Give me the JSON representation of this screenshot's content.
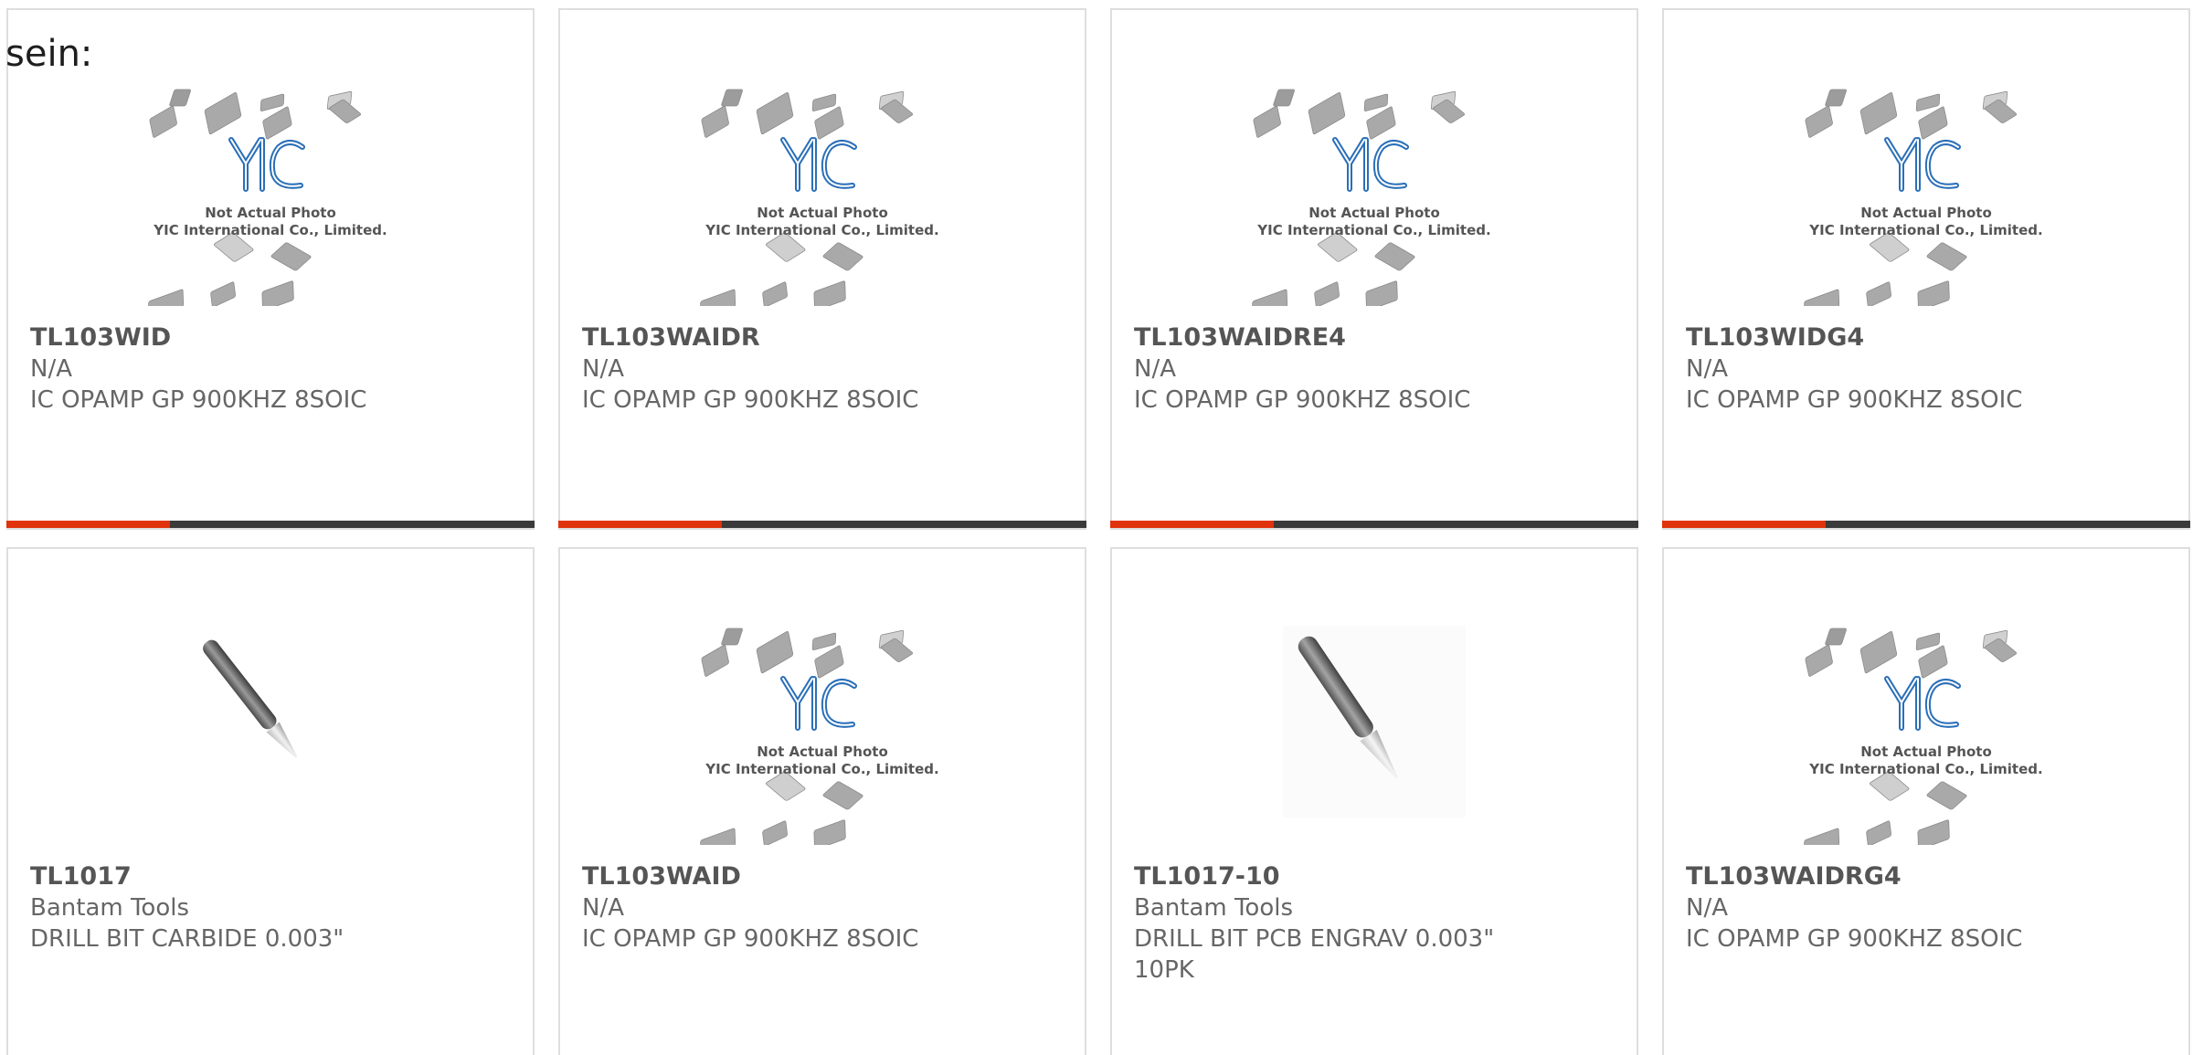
{
  "label": "sein:",
  "accent_color": "#e0320c",
  "bar_color": "#3a3a3a",
  "products": [
    {
      "part": "TL103WID",
      "mfr": "N/A",
      "desc": "IC OPAMP GP 900KHZ 8SOIC",
      "image": "yic-placeholder",
      "progress": 0.31
    },
    {
      "part": "TL103WAIDR",
      "mfr": "N/A",
      "desc": "IC OPAMP GP 900KHZ 8SOIC",
      "image": "yic-placeholder",
      "progress": 0.31
    },
    {
      "part": "TL103WAIDRE4",
      "mfr": "N/A",
      "desc": "IC OPAMP GP 900KHZ 8SOIC",
      "image": "yic-placeholder",
      "progress": 0.31
    },
    {
      "part": "TL103WIDG4",
      "mfr": "N/A",
      "desc": "IC OPAMP GP 900KHZ 8SOIC",
      "image": "yic-placeholder",
      "progress": 0.31
    },
    {
      "part": "TL1017",
      "mfr": "Bantam Tools",
      "desc": "DRILL BIT CARBIDE 0.003\"",
      "image": "drill-bit"
    },
    {
      "part": "TL103WAID",
      "mfr": "N/A",
      "desc": "IC OPAMP GP 900KHZ 8SOIC",
      "image": "yic-placeholder"
    },
    {
      "part": "TL1017-10",
      "mfr": "Bantam Tools",
      "desc": "DRILL BIT PCB ENGRAV 0.003\" 10PK",
      "image": "drill-bit"
    },
    {
      "part": "TL103WAIDRG4",
      "mfr": "N/A",
      "desc": "IC OPAMP GP 900KHZ 8SOIC",
      "image": "yic-placeholder"
    }
  ],
  "placeholder_text": {
    "line1": "Not Actual Photo",
    "line2": "YIC International Co., Limited."
  }
}
